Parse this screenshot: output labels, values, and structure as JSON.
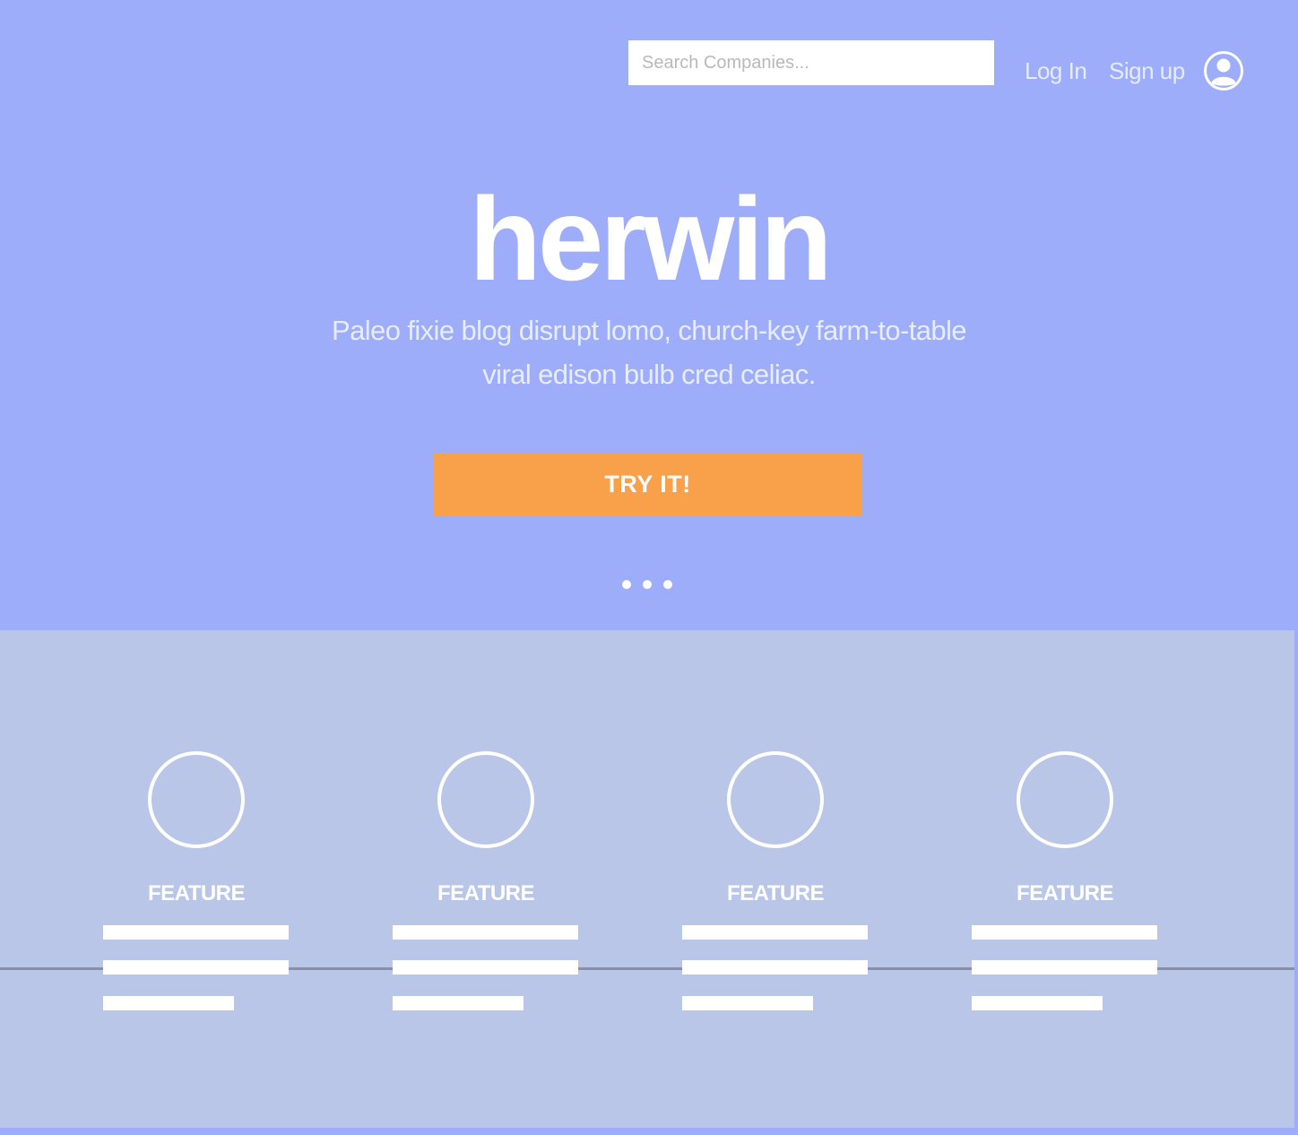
{
  "header": {
    "search": {
      "placeholder": "Search Companies...",
      "value": ""
    },
    "login_label": "Log In",
    "signup_label": "Sign up",
    "avatar_icon": "user-circle-icon"
  },
  "hero": {
    "brand": "herwin",
    "tagline_line1": "Paleo fixie blog disrupt lomo, church-key farm-to-table",
    "tagline_line2": "viral edison bulb cred celiac.",
    "cta_label": "TRY IT!",
    "carousel_dots": 3
  },
  "features": [
    {
      "label": "FEATURE",
      "icon": "circle-icon"
    },
    {
      "label": "FEATURE",
      "icon": "circle-icon"
    },
    {
      "label": "FEATURE",
      "icon": "circle-icon"
    },
    {
      "label": "FEATURE",
      "icon": "circle-icon"
    }
  ],
  "colors": {
    "hero_bg": "#9dadf9",
    "features_bg": "#bac6e8",
    "cta_bg": "#f9a04a",
    "text_light": "#ffffff"
  }
}
